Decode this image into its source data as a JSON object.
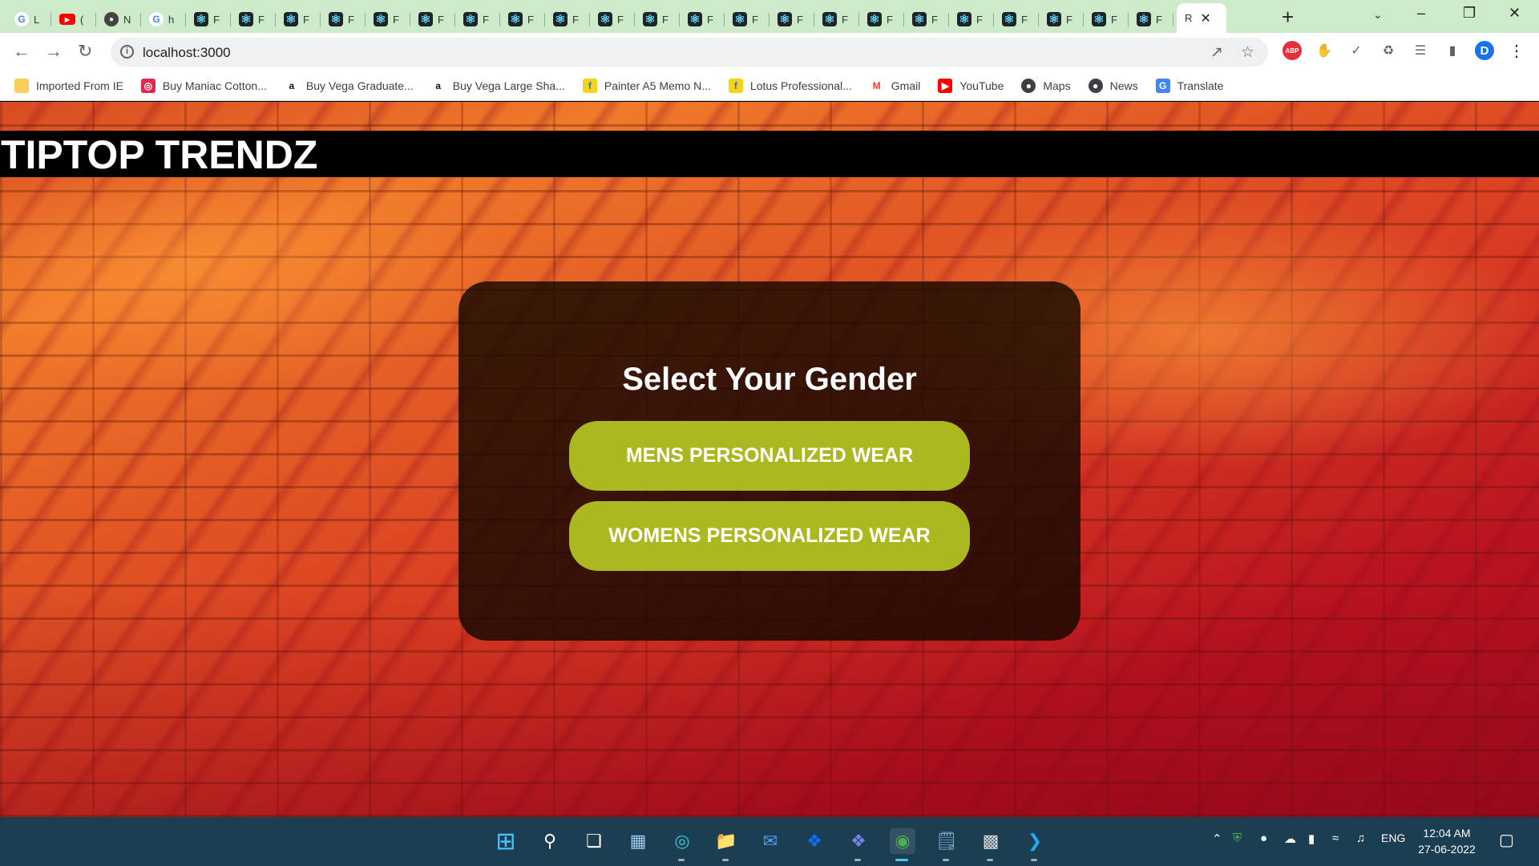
{
  "browser": {
    "tabs": [
      {
        "icon": "google-icon",
        "letter": "L"
      },
      {
        "icon": "youtube-icon",
        "letter": "("
      },
      {
        "icon": "github-icon",
        "letter": "N"
      },
      {
        "icon": "google-icon",
        "letter": "h"
      },
      {
        "icon": "react-icon",
        "letter": "F"
      },
      {
        "icon": "react-icon",
        "letter": "F"
      },
      {
        "icon": "react-icon",
        "letter": "F"
      },
      {
        "icon": "react-icon",
        "letter": "F"
      },
      {
        "icon": "react-icon",
        "letter": "F"
      },
      {
        "icon": "react-icon",
        "letter": "F"
      },
      {
        "icon": "react-icon",
        "letter": "F"
      },
      {
        "icon": "react-icon",
        "letter": "F"
      },
      {
        "icon": "react-icon",
        "letter": "F"
      },
      {
        "icon": "react-icon",
        "letter": "F"
      },
      {
        "icon": "react-icon",
        "letter": "F"
      },
      {
        "icon": "react-icon",
        "letter": "F"
      },
      {
        "icon": "react-icon",
        "letter": "F"
      },
      {
        "icon": "react-icon",
        "letter": "F"
      },
      {
        "icon": "react-icon",
        "letter": "F"
      },
      {
        "icon": "react-icon",
        "letter": "F"
      },
      {
        "icon": "react-icon",
        "letter": "F"
      },
      {
        "icon": "react-icon",
        "letter": "F"
      },
      {
        "icon": "react-icon",
        "letter": "F"
      },
      {
        "icon": "react-icon",
        "letter": "F"
      },
      {
        "icon": "react-icon",
        "letter": "F"
      },
      {
        "icon": "react-icon",
        "letter": "F"
      }
    ],
    "active_tab": {
      "icon": "react-icon",
      "letter": "R"
    },
    "url": "localhost:3000",
    "bookmarks": [
      {
        "label": "Imported From IE",
        "icon": "folder-icon"
      },
      {
        "label": "Buy Maniac Cotton...",
        "icon": "maniac-icon"
      },
      {
        "label": "Buy Vega Graduate...",
        "icon": "amazon-icon"
      },
      {
        "label": "Buy Vega Large Sha...",
        "icon": "amazon-icon"
      },
      {
        "label": "Painter A5 Memo N...",
        "icon": "flipkart-icon"
      },
      {
        "label": "Lotus Professional...",
        "icon": "flipkart-icon"
      },
      {
        "label": "Gmail",
        "icon": "gmail-icon"
      },
      {
        "label": "YouTube",
        "icon": "youtube-icon"
      },
      {
        "label": "Maps",
        "icon": "globe-icon"
      },
      {
        "label": "News",
        "icon": "globe-icon"
      },
      {
        "label": "Translate",
        "icon": "translate-icon"
      }
    ],
    "profile_initial": "D"
  },
  "page": {
    "brand": "TIPTOP TRENDZ",
    "card_title": "Select Your Gender",
    "mens_button": "MENS PERSONALIZED WEAR",
    "womens_button": "WOMENS PERSONALIZED WEAR",
    "accent_color": "#abb81f"
  },
  "taskbar": {
    "language": "ENG",
    "time": "12:04 AM",
    "date": "27-06-2022"
  }
}
